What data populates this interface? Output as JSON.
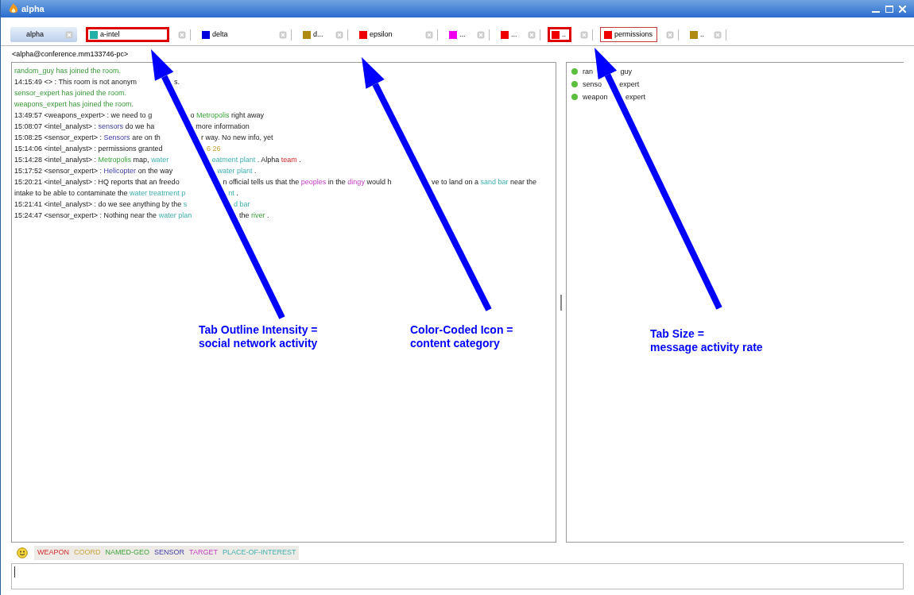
{
  "window": {
    "title": "alpha"
  },
  "tabs": [
    {
      "label": "alpha",
      "selected": true,
      "outlined": false
    },
    {
      "label": "a-intel",
      "color": "#20b0a8",
      "selected": false,
      "outlined": true,
      "outline_strong": true
    },
    {
      "label": "delta",
      "color": "#0000dd",
      "selected": false,
      "outlined": false
    },
    {
      "label": "d...",
      "color": "#b08a10",
      "selected": false,
      "outlined": false
    },
    {
      "label": "epsilon",
      "color": "#ee0000",
      "selected": false,
      "outlined": false
    },
    {
      "label": "...",
      "color": "#ee00ee",
      "selected": false,
      "outlined": false
    },
    {
      "label": "...",
      "color": "#ee0000",
      "selected": false,
      "outlined": false
    },
    {
      "label": "..",
      "color": "#ee0000",
      "selected": false,
      "outlined": true,
      "outline_strong": true
    },
    {
      "label": "permissions",
      "color": "#ee0000",
      "selected": false,
      "outlined": true,
      "outline_strong": false
    },
    {
      "label": "..",
      "color": "#b08a10",
      "selected": false,
      "outlined": false
    }
  ],
  "room_address": "<alpha@conference.mm133746-pc>",
  "messages": [
    {
      "lines": [
        {
          "pieces": [
            {
              "segments": [
                {
                  "kind": "system",
                  "text": "random_guy has joined the room."
                }
              ]
            }
          ]
        }
      ]
    },
    {
      "lines": [
        {
          "pieces": [
            {
              "segments": [
                {
                  "kind": "plain",
                  "text": "14:15:49 <> : This room is not anonym"
                }
              ]
            },
            {
              "segments": [
                {
                  "kind": "plain",
                  "text": "s."
                }
              ]
            }
          ]
        }
      ]
    },
    {
      "lines": [
        {
          "pieces": [
            {
              "segments": [
                {
                  "kind": "system",
                  "text": "sensor_expert has joined the room."
                }
              ]
            }
          ]
        }
      ]
    },
    {
      "lines": [
        {
          "pieces": [
            {
              "segments": [
                {
                  "kind": "system",
                  "text": "weapons_expert has joined the room."
                }
              ]
            }
          ]
        }
      ]
    },
    {
      "lines": [
        {
          "pieces": [
            {
              "segments": [
                {
                  "kind": "plain",
                  "text": "13:49:57 <weapons_expert> : we need to g"
                }
              ]
            },
            {
              "segments": [
                {
                  "kind": "plain",
                  "text": "o "
                },
                {
                  "kind": "named-geo",
                  "text": "Metropolis"
                },
                {
                  "kind": "plain",
                  "text": " right away"
                }
              ]
            }
          ]
        }
      ]
    },
    {
      "lines": [
        {
          "pieces": [
            {
              "segments": [
                {
                  "kind": "plain",
                  "text": "15:08:07 <intel_analyst> : "
                },
                {
                  "kind": "sensor",
                  "text": "sensors"
                },
                {
                  "kind": "plain",
                  "text": " do we ha"
                }
              ]
            },
            {
              "segments": [
                {
                  "kind": "plain",
                  "text": "more information"
                }
              ]
            }
          ]
        }
      ]
    },
    {
      "lines": [
        {
          "pieces": [
            {
              "segments": [
                {
                  "kind": "plain",
                  "text": "15:08:25 <sensor_expert> : "
                },
                {
                  "kind": "sensor",
                  "text": "Sensors"
                },
                {
                  "kind": "plain",
                  "text": " are on th"
                }
              ]
            },
            {
              "segments": [
                {
                  "kind": "plain",
                  "text": "r way. No new info, yet"
                }
              ]
            }
          ]
        }
      ]
    },
    {
      "lines": [
        {
          "pieces": [
            {
              "segments": [
                {
                  "kind": "plain",
                  "text": "15:14:06 <intel_analyst> : permissions granted"
                }
              ]
            },
            {
              "segments": [
                {
                  "kind": "coord",
                  "text": "6 26"
                }
              ]
            }
          ]
        }
      ]
    },
    {
      "lines": [
        {
          "pieces": [
            {
              "segments": [
                {
                  "kind": "plain",
                  "text": "15:14:28 <intel_analyst> : "
                },
                {
                  "kind": "named-geo",
                  "text": "Metropolis"
                },
                {
                  "kind": "plain",
                  "text": " map, "
                },
                {
                  "kind": "place-of-interest",
                  "text": "water"
                }
              ]
            },
            {
              "segments": [
                {
                  "kind": "place-of-interest",
                  "text": "eatment plant"
                },
                {
                  "kind": "plain",
                  "text": " . Alpha "
                },
                {
                  "kind": "weapon",
                  "text": "team"
                },
                {
                  "kind": "plain",
                  "text": " ."
                }
              ]
            }
          ]
        }
      ]
    },
    {
      "lines": [
        {
          "pieces": [
            {
              "segments": [
                {
                  "kind": "plain",
                  "text": "15:17:52 <sensor_expert> : "
                },
                {
                  "kind": "sensor",
                  "text": "Helicopter"
                },
                {
                  "kind": "plain",
                  "text": " on the way"
                }
              ]
            },
            {
              "segments": [
                {
                  "kind": "place-of-interest",
                  "text": "water plant"
                },
                {
                  "kind": "plain",
                  "text": " ."
                }
              ]
            }
          ]
        }
      ]
    },
    {
      "lines": [
        {
          "pieces": [
            {
              "segments": [
                {
                  "kind": "plain",
                  "text": "15:20:21 <intel_analyst> : HQ reports that an freedo"
                }
              ]
            },
            {
              "segments": [
                {
                  "kind": "plain",
                  "text": "n official tells us that the "
                },
                {
                  "kind": "target",
                  "text": "peoples"
                },
                {
                  "kind": "plain",
                  "text": " in the "
                },
                {
                  "kind": "target",
                  "text": "dingy"
                },
                {
                  "kind": "plain",
                  "text": " would h"
                }
              ]
            },
            {
              "segments": [
                {
                  "kind": "plain",
                  "text": "ve to land on a "
                },
                {
                  "kind": "place-of-interest",
                  "text": "sand bar"
                },
                {
                  "kind": "plain",
                  "text": " near the"
                }
              ]
            }
          ]
        },
        {
          "pieces": [
            {
              "segments": [
                {
                  "kind": "plain",
                  "text": "intake to be able to contaminate the "
                },
                {
                  "kind": "place-of-interest",
                  "text": "water treatment p"
                }
              ]
            },
            {
              "segments": [
                {
                  "kind": "place-of-interest",
                  "text": "nt"
                },
                {
                  "kind": "plain",
                  "text": " ."
                }
              ]
            }
          ]
        }
      ]
    },
    {
      "lines": [
        {
          "pieces": [
            {
              "segments": [
                {
                  "kind": "plain",
                  "text": "15:21:41 <intel_analyst> : do we see anything by the "
                },
                {
                  "kind": "place-of-interest",
                  "text": "s"
                }
              ]
            },
            {
              "segments": [
                {
                  "kind": "place-of-interest",
                  "text": "d bar"
                }
              ]
            }
          ]
        }
      ]
    },
    {
      "lines": [
        {
          "pieces": [
            {
              "segments": [
                {
                  "kind": "plain",
                  "text": "15:24:47 <sensor_expert> : Nothing near the "
                },
                {
                  "kind": "place-of-interest",
                  "text": "water plan"
                }
              ]
            },
            {
              "segments": [
                {
                  "kind": "plain",
                  "text": "the "
                },
                {
                  "kind": "named-geo",
                  "text": "river"
                },
                {
                  "kind": "plain",
                  "text": " ."
                }
              ]
            }
          ]
        }
      ]
    }
  ],
  "occupants": [
    {
      "name_parts": [
        "ran",
        "guy"
      ],
      "online": true
    },
    {
      "name_parts": [
        "senso",
        "expert"
      ],
      "online": true
    },
    {
      "name_parts": [
        "weapon",
        "expert"
      ],
      "online": true
    }
  ],
  "categories": [
    {
      "kind": "weapon",
      "label": "WEAPON"
    },
    {
      "kind": "coord",
      "label": "COORD"
    },
    {
      "kind": "named-geo",
      "label": "NAMED-GEO"
    },
    {
      "kind": "sensor",
      "label": "SENSOR"
    },
    {
      "kind": "target",
      "label": "TARGET"
    },
    {
      "kind": "place-of-interest",
      "label": "PLACE-OF-INTEREST"
    }
  ],
  "annotations": [
    {
      "lines": [
        "Tab Outline Intensity =",
        "social network activity"
      ]
    },
    {
      "lines": [
        "Color-Coded Icon =",
        "content category"
      ]
    },
    {
      "lines": [
        "Tab Size =",
        "message activity rate"
      ]
    }
  ]
}
